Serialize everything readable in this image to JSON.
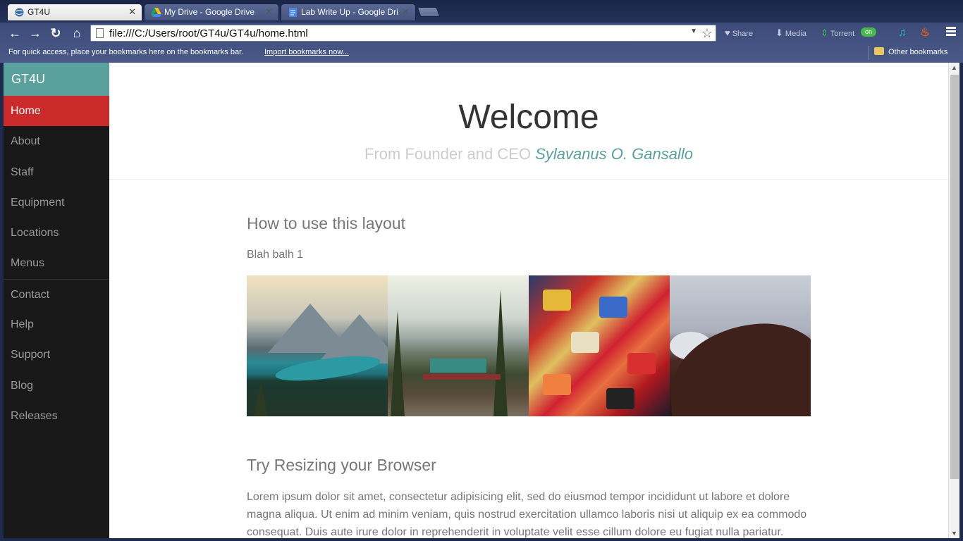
{
  "browser": {
    "tabs": [
      {
        "label": "GT4U",
        "active": true
      },
      {
        "label": "My Drive - Google Drive",
        "active": false
      },
      {
        "label": "Lab Write Up - Google Dri",
        "active": false
      }
    ],
    "url": "file:///C:/Users/root/GT4u/GT4u/home.html",
    "extensions": {
      "share": "Share",
      "media": "Media",
      "torrent": "Torrent",
      "on_badge": "on"
    },
    "bookmarks_bar": {
      "message": "For quick access, place your bookmarks here on the bookmarks bar.",
      "import_link": "Import bookmarks now...",
      "other": "Other bookmarks"
    }
  },
  "sidebar": {
    "brand": "GT4U",
    "items": [
      {
        "label": "Home",
        "active": true
      },
      {
        "label": "About"
      },
      {
        "label": "Staff"
      },
      {
        "label": "Equipment"
      },
      {
        "label": "Locations"
      },
      {
        "label": "Menus"
      },
      {
        "label": "Contact"
      },
      {
        "label": "Help"
      },
      {
        "label": "Support"
      },
      {
        "label": "Blog"
      },
      {
        "label": "Releases"
      }
    ]
  },
  "header": {
    "title": "Welcome",
    "subtitle_prefix": "From Founder and CEO",
    "subtitle_name": "Sylavanus O. Gansallo"
  },
  "content": {
    "section1_title": "How to use this layout",
    "section1_text": "Blah balh 1",
    "section2_title": "Try Resizing your Browser",
    "section2_text": "Lorem ipsum dolor sit amet, consectetur adipisicing elit, sed do eiusmod tempor incididunt ut labore et dolore magna aliqua. Ut enim ad minim veniam, quis nostrud exercitation ullamco laboris nisi ut aliquip ex ea commodo consequat. Duis aute irure dolor in reprehenderit in voluptate velit esse cillum dolore eu fugiat nulla pariatur."
  },
  "colors": {
    "brand": "#5aa09c",
    "active_nav": "#cb2a2a",
    "sidebar_bg": "#191818"
  }
}
